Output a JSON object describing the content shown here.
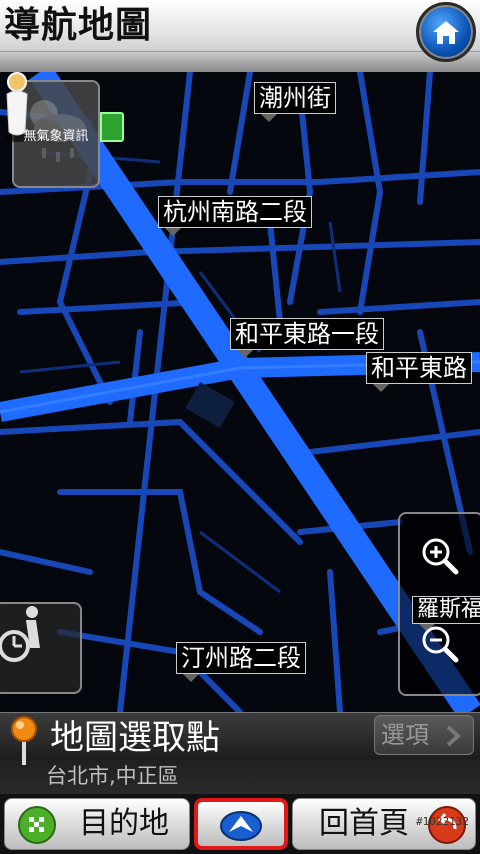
{
  "header": {
    "title": "導航地圖",
    "home_icon": "home-icon"
  },
  "map": {
    "street_labels": [
      "潮州街",
      "杭州南路二段",
      "和平東路一段",
      "和平東路",
      "汀州路二段",
      "羅斯福"
    ],
    "weather_text": "無氣象資訊",
    "colors": {
      "background": "#05070f",
      "main_road": "#1f6bff",
      "road": "#1848b8"
    }
  },
  "info_bar": {
    "title": "地圖選取點",
    "subtitle": "台北市,中正區",
    "options_label": "選項"
  },
  "bottom_bar": {
    "destination_label": "目的地",
    "home_label": "回首頁",
    "watermark": "#1022132",
    "active_button_color": "#e01818"
  }
}
